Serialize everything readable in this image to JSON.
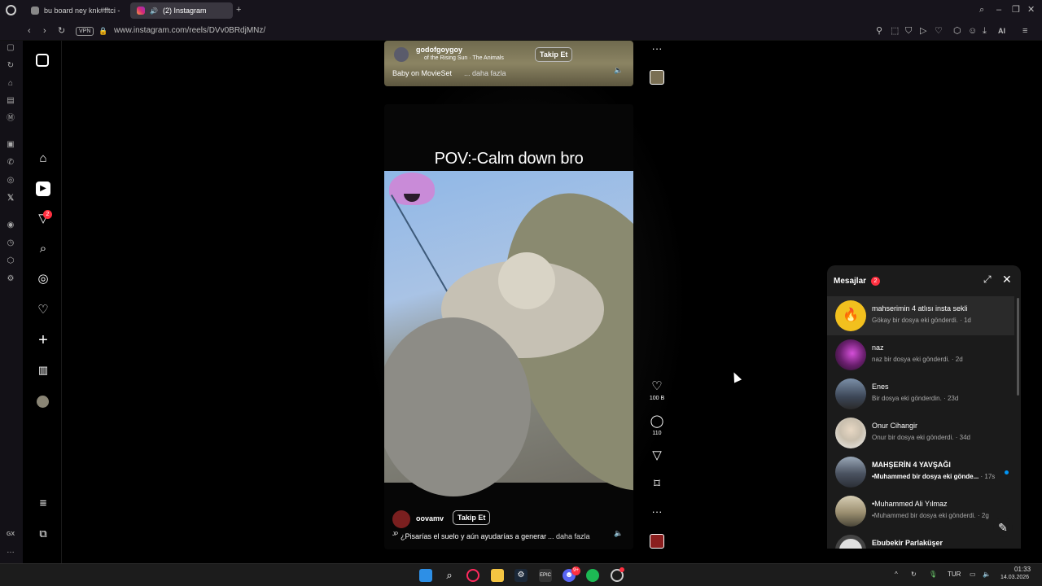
{
  "browser": {
    "tabs": [
      {
        "title": "bu board ney knk#fftci - S",
        "active": false
      },
      {
        "title": "(2) Instagram",
        "active": true
      }
    ],
    "url": "www.instagram.com/reels/DVv0BRdjMNz/",
    "vpn_label": "VPN",
    "ai_label": "AI"
  },
  "opera_sidebar": {
    "bottom_label": "GX",
    "icons": [
      "home-icon",
      "refresh-icon",
      "gaming-icon",
      "news-icon",
      "m-icon",
      "twitch-icon",
      "whatsapp-icon",
      "instagram-icon",
      "x-icon",
      "player-icon",
      "history-icon",
      "extensions-icon",
      "settings-icon"
    ]
  },
  "ig_nav": {
    "notification_badge": "2",
    "items": [
      "home-icon",
      "reels-icon",
      "messages-icon",
      "search-icon",
      "explore-icon",
      "notifications-icon",
      "create-icon",
      "dashboard-icon",
      "profile-icon"
    ]
  },
  "reel_top": {
    "username": "godofgoygoy",
    "audio": "of the Rising Sun · The Animals",
    "follow_label": "Takip Et",
    "caption": "Baby on MovieSet",
    "more_label": "... daha fazla"
  },
  "reel_main": {
    "overlay_text": "POV:-Calm down bro",
    "username": "oovamv",
    "follow_label": "Takip Et",
    "caption": "¿Pisarías el suelo y aún ayudarías a generar",
    "caption_prefix": "JP",
    "more_label": "... daha fazla"
  },
  "actions": {
    "likes": "100 B",
    "comments": "110"
  },
  "messages": {
    "title": "Mesajlar",
    "badge": "2",
    "conversations": [
      {
        "name": "mahserimin 4 atlısı insta sekli",
        "preview": "Gökay bir dosya eki gönderdi.",
        "time": "· 1d",
        "unread": false,
        "avatar_color": "#f2c01e"
      },
      {
        "name": "naz",
        "preview": "naz bir dosya eki gönderdi.",
        "time": "· 2d",
        "unread": false,
        "avatar_color": "#8a2a8f"
      },
      {
        "name": "Enes",
        "preview": "Bir dosya eki gönderdin.",
        "time": "· 23d",
        "unread": false,
        "avatar_color": "#4b5a70"
      },
      {
        "name": "Onur Cihangir",
        "preview": "Onur bir dosya eki gönderdi.",
        "time": "· 34d",
        "unread": false,
        "avatar_color": "#d9d2c5"
      },
      {
        "name": "MAHŞERİN 4 YAVŞAĞI",
        "preview": "•Muhammed bir dosya eki gönde...",
        "time": "· 17s",
        "unread": true,
        "avatar_color": "#6c7a8a"
      },
      {
        "name": "•Muhammed Ali Yılmaz",
        "preview": "•Muhammed bir dosya eki gönderdi.",
        "time": "· 2g",
        "unread": false,
        "avatar_color": "#a89a7a"
      },
      {
        "name": "Ebubekir Parlaküşer",
        "preview": "",
        "time": "",
        "unread": false,
        "avatar_color": "#cfcfcf"
      }
    ]
  },
  "taskbar": {
    "language": "TUR",
    "time": "01:33",
    "date": "14.03.2026",
    "discord_badge": "9+"
  },
  "colors": {
    "accent": "#ff3040",
    "unread_dot": "#0095f6"
  }
}
